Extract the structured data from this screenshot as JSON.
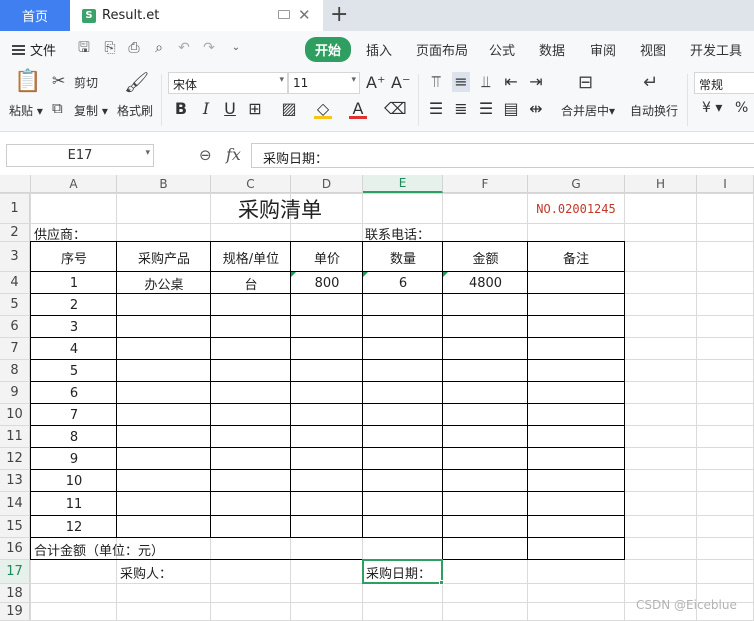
{
  "tabs": {
    "home": "首页",
    "file_logo": "S",
    "file_name": "Result.et",
    "new_tab": "+"
  },
  "menu": {
    "file": "文件",
    "tabs": [
      "开始",
      "插入",
      "页面布局",
      "公式",
      "数据",
      "审阅",
      "视图",
      "开发工具"
    ]
  },
  "ribbon": {
    "paste": "粘贴",
    "cut": "剪切",
    "copy": "复制",
    "format_painter": "格式刷",
    "font_name": "宋体",
    "font_size": "11",
    "merge_center": "合并居中",
    "wrap_text": "自动换行",
    "number_format": "常规",
    "currency_symbol": "¥",
    "percent_symbol": "%"
  },
  "formula_bar": {
    "cell_ref": "E17",
    "fx": "fx",
    "value": "采购日期："
  },
  "columns": [
    "A",
    "B",
    "C",
    "D",
    "E",
    "F",
    "G",
    "H",
    "I"
  ],
  "rows": [
    "1",
    "2",
    "3",
    "4",
    "5",
    "6",
    "7",
    "8",
    "9",
    "10",
    "11",
    "12",
    "13",
    "14",
    "15",
    "16",
    "17",
    "18",
    "19"
  ],
  "sheet": {
    "title": "采购清单",
    "doc_no": "NO.02001245",
    "doc_no_color": "#c0392b",
    "supplier_label": "供应商：",
    "phone_label": "联系电话：",
    "headers": [
      "序号",
      "采购产品",
      "规格/单位",
      "单价",
      "数量",
      "金额",
      "备注"
    ],
    "first_item": {
      "seq": "1",
      "product": "办公桌",
      "unit": "台",
      "price": "800",
      "qty": "6",
      "amount": "4800"
    },
    "seq_numbers": [
      "2",
      "3",
      "4",
      "5",
      "6",
      "7",
      "8",
      "9",
      "10",
      "11",
      "12"
    ],
    "total_label": "合计金额（单位：元）",
    "buyer_label": "采购人：",
    "date_label": "采购日期："
  },
  "watermark": "CSDN @Eiceblue",
  "accent_color": "#2e9e61"
}
